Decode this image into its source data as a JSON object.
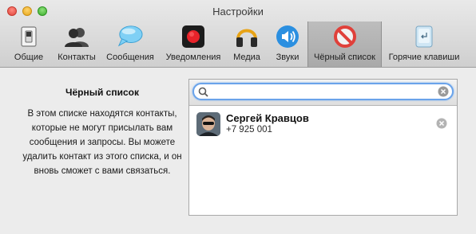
{
  "window": {
    "title": "Настройки"
  },
  "toolbar": {
    "items": [
      {
        "label": "Общие",
        "icon": "switch-icon"
      },
      {
        "label": "Контакты",
        "icon": "contacts-icon"
      },
      {
        "label": "Сообщения",
        "icon": "speech-bubble-icon"
      },
      {
        "label": "Уведомления",
        "icon": "record-icon"
      },
      {
        "label": "Медиа",
        "icon": "headphones-icon"
      },
      {
        "label": "Звуки",
        "icon": "speaker-icon"
      },
      {
        "label": "Чёрный список",
        "icon": "blocked-icon",
        "selected": true
      },
      {
        "label": "Горячие клавиши",
        "icon": "keyboard-key-icon"
      }
    ]
  },
  "blacklist": {
    "title": "Чёрный список",
    "description": "В этом списке находятся контакты, которые не могут присылать вам сообщения и запросы. Вы можете удалить контакт из этого списка, и он вновь сможет с вами связаться.",
    "search": {
      "value": "",
      "placeholder": ""
    },
    "contacts": [
      {
        "name": "Сергей Кравцов",
        "phone": "+7 925 001"
      }
    ]
  },
  "colors": {
    "focus_ring": "#6aa3ea",
    "blocked_red": "#e0403a",
    "record_red": "#e8232a",
    "speaker_blue": "#2b8fe0"
  }
}
